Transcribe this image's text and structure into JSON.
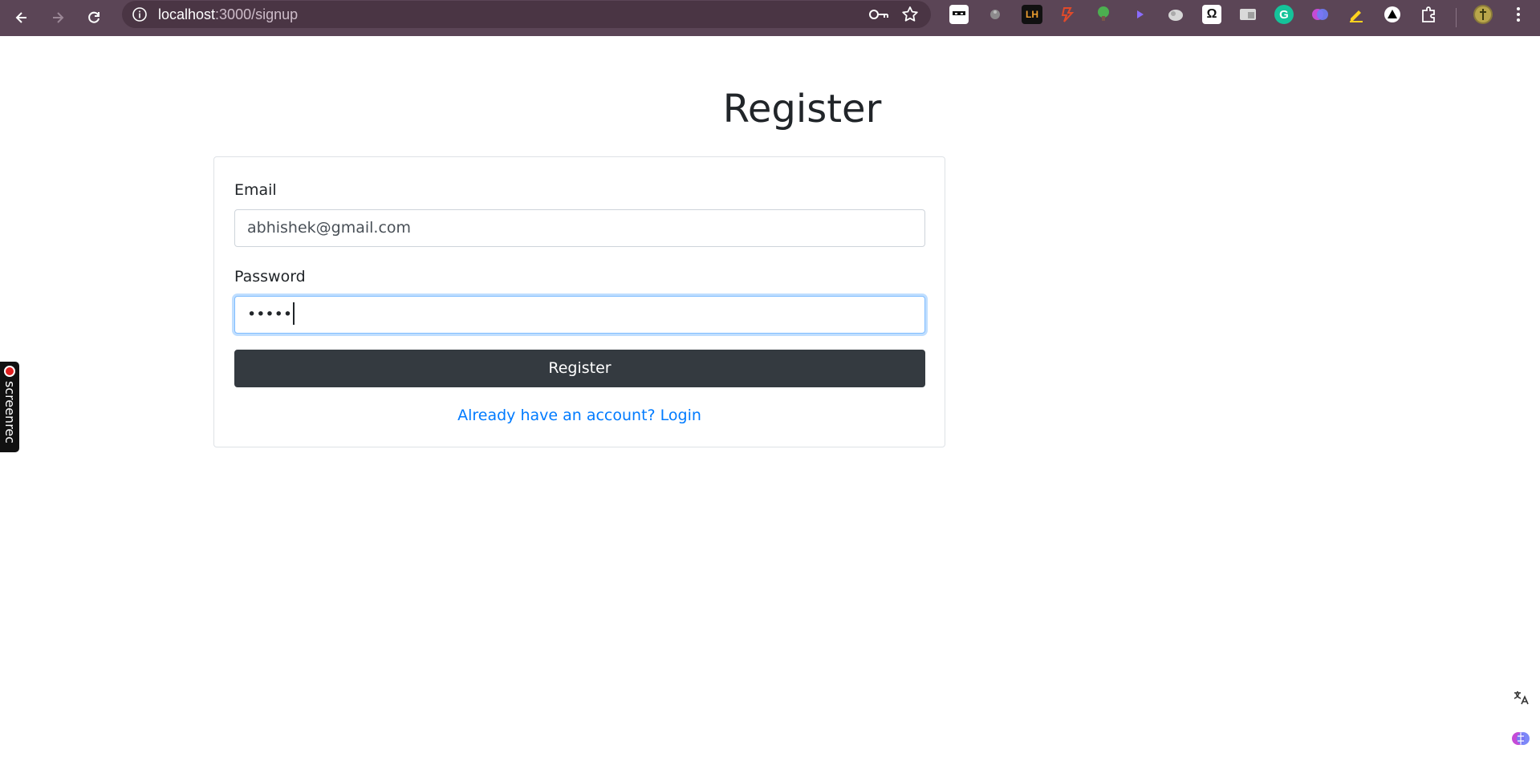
{
  "browser": {
    "url_host": "localhost",
    "url_path": ":3000/signup",
    "colors": {
      "toolbar": "#5b4556",
      "omnibox": "#4a3544"
    },
    "extensions": [
      {
        "name": "ext-ninja-icon",
        "glyph": ""
      },
      {
        "name": "ext-gray-icon",
        "glyph": ""
      },
      {
        "name": "ext-lighthouse-icon",
        "glyph": "LH"
      },
      {
        "name": "ext-red-icon",
        "glyph": ""
      },
      {
        "name": "ext-tree-icon",
        "glyph": ""
      },
      {
        "name": "ext-play-icon",
        "glyph": ""
      },
      {
        "name": "ext-cloud-icon",
        "glyph": ""
      },
      {
        "name": "ext-omega-icon",
        "glyph": "Ω"
      },
      {
        "name": "ext-window-icon",
        "glyph": ""
      },
      {
        "name": "ext-grammarly-icon",
        "glyph": "G"
      },
      {
        "name": "ext-brain-icon",
        "glyph": ""
      },
      {
        "name": "ext-highlighter-icon",
        "glyph": ""
      },
      {
        "name": "ext-triangle-icon",
        "glyph": ""
      }
    ]
  },
  "page": {
    "title": "Register",
    "form": {
      "email_label": "Email",
      "email_value": "abhishek@gmail.com",
      "password_label": "Password",
      "password_value": "•••••",
      "submit_label": "Register",
      "login_link": "Already have an account? Login"
    },
    "colors": {
      "button_bg": "#343a40",
      "link": "#007bff",
      "focus_border": "#80bdff"
    }
  },
  "overlay": {
    "screenrec_label": "screenrec"
  }
}
